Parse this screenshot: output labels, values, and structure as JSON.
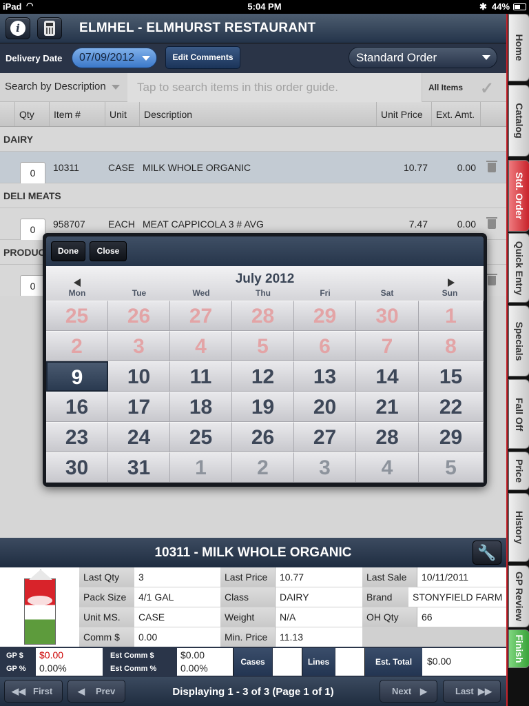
{
  "status_bar": {
    "carrier": "iPad",
    "time": "5:04 PM",
    "battery": "44%"
  },
  "header": {
    "title": "ELMHEL - ELMHURST RESTAURANT"
  },
  "delivery": {
    "label": "Delivery Date",
    "date": "07/09/2012",
    "edit_comments": "Edit Comments",
    "order_type": "Standard Order"
  },
  "search": {
    "mode": "Search by Description",
    "placeholder": "Tap to search items in this order guide.",
    "filter": "All Items"
  },
  "columns": {
    "qty": "Qty",
    "item": "Item #",
    "unit": "Unit",
    "description": "Description",
    "unit_price": "Unit Price",
    "ext_amt": "Ext. Amt."
  },
  "categories": [
    {
      "name": "DAIRY",
      "items": [
        {
          "qty": "0",
          "item": "10311",
          "unit": "CASE",
          "description": "MILK WHOLE ORGANIC",
          "unit_price": "10.77",
          "ext_amt": "0.00"
        }
      ]
    },
    {
      "name": "DELI MEATS",
      "items": [
        {
          "qty": "0",
          "item": "958707",
          "unit": "EACH",
          "description": "MEAT CAPPICOLA 3 # AVG",
          "unit_price": "7.47",
          "ext_amt": "0.00"
        }
      ]
    },
    {
      "name": "PRODUC",
      "items": [
        {
          "qty": "0"
        }
      ]
    }
  ],
  "calendar": {
    "done": "Done",
    "close": "Close",
    "month": "July 2012",
    "weekdays": [
      "Mon",
      "Tue",
      "Wed",
      "Thu",
      "Fri",
      "Sat",
      "Sun"
    ],
    "selected_day": "9",
    "weeks": [
      [
        "25",
        "26",
        "27",
        "28",
        "29",
        "30",
        "1"
      ],
      [
        "2",
        "3",
        "4",
        "5",
        "6",
        "7",
        "8"
      ],
      [
        "9",
        "10",
        "11",
        "12",
        "13",
        "14",
        "15"
      ],
      [
        "16",
        "17",
        "18",
        "19",
        "20",
        "21",
        "22"
      ],
      [
        "23",
        "24",
        "25",
        "26",
        "27",
        "28",
        "29"
      ],
      [
        "30",
        "31",
        "1",
        "2",
        "3",
        "4",
        "5"
      ]
    ]
  },
  "detail": {
    "title": "10311 - MILK WHOLE ORGANIC",
    "fields": {
      "last_qty": {
        "label": "Last Qty",
        "value": "3"
      },
      "pack_size": {
        "label": "Pack Size",
        "value": "4/1 GAL"
      },
      "unit_ms": {
        "label": "Unit MS.",
        "value": "CASE"
      },
      "comm": {
        "label": "Comm $",
        "value": "0.00"
      },
      "last_price": {
        "label": "Last Price",
        "value": "10.77"
      },
      "class": {
        "label": "Class",
        "value": "DAIRY"
      },
      "weight": {
        "label": "Weight",
        "value": "N/A"
      },
      "min_price": {
        "label": "Min. Price",
        "value": "11.13"
      },
      "last_sale": {
        "label": "Last Sale",
        "value": "10/11/2011"
      },
      "brand": {
        "label": "Brand",
        "value": "STONYFIELD FARM"
      },
      "oh_qty": {
        "label": "OH Qty",
        "value": "66"
      }
    }
  },
  "totals": {
    "gp_dollar_label": "GP $",
    "gp_pct_label": "GP %",
    "gp_dollar": "$0.00",
    "gp_pct": "0.00%",
    "est_comm_dollar_label": "Est Comm $",
    "est_comm_pct_label": "Est Comm %",
    "est_comm_dollar": "$0.00",
    "est_comm_pct": "0.00%",
    "cases": "Cases",
    "lines": "Lines",
    "est_total_label": "Est. Total",
    "est_total": "$0.00"
  },
  "pager": {
    "first": "First",
    "prev": "Prev",
    "display": "Displaying 1 - 3 of 3 (Page 1 of 1)",
    "next": "Next",
    "last": "Last"
  },
  "sidenav": [
    "Home",
    "Catalog",
    "Std. Order",
    "Quick Entry",
    "Specials",
    "Fall Off",
    "Price",
    "History",
    "GP Review",
    "Finish"
  ],
  "sidenav_active": "Std. Order",
  "colors": {
    "accent_red": "#c8232b",
    "selected_row": "#c3cbd3",
    "finish_green": "#3aa33a",
    "gp_red": "#cc0000"
  }
}
